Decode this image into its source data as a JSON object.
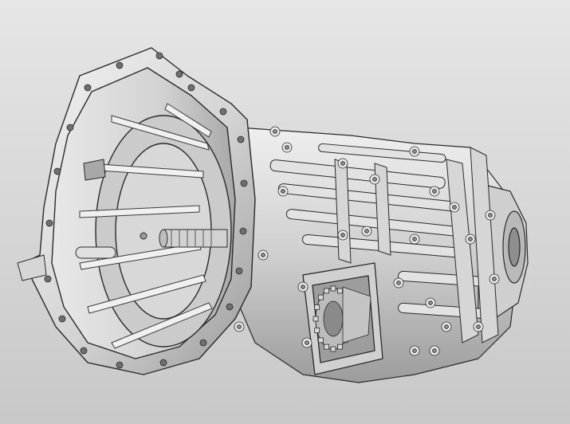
{
  "viewport": {
    "background_top": "#e6e6e6",
    "background_bottom": "#c8c8c8"
  },
  "model": {
    "subject": "gearbox-housing",
    "material_color": "#d9d9d9",
    "edge_color": "#2a2a2a",
    "highlight_color": "#f5f5f5",
    "shadow_color": "#8c8c8c"
  }
}
